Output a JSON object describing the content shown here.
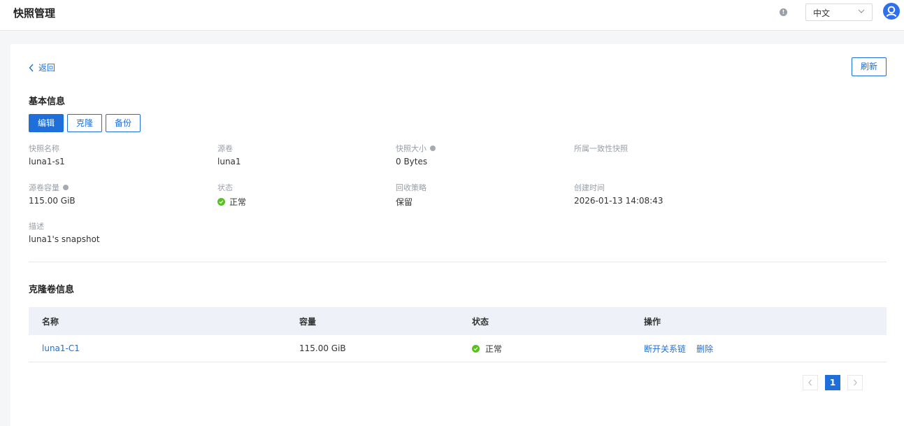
{
  "header": {
    "title": "快照管理",
    "language": "中文"
  },
  "toolbar": {
    "back_label": "返回",
    "refresh_label": "刷新"
  },
  "basic_info": {
    "title": "基本信息",
    "actions": {
      "edit": "编辑",
      "clone": "克隆",
      "backup": "备份"
    },
    "fields": {
      "snapshot_name": {
        "label": "快照名称",
        "value": "luna1-s1"
      },
      "source_volume": {
        "label": "源卷",
        "value": "luna1"
      },
      "snapshot_size": {
        "label": "快照大小",
        "value": "0 Bytes"
      },
      "consistency_group": {
        "label": "所属一致性快照",
        "value": ""
      },
      "source_capacity": {
        "label": "源卷容量",
        "value": "115.00 GiB"
      },
      "status": {
        "label": "状态",
        "value": "正常"
      },
      "recycle_policy": {
        "label": "回收策略",
        "value": "保留"
      },
      "created_at": {
        "label": "创建时间",
        "value": "2026-01-13 14:08:43"
      },
      "description": {
        "label": "描述",
        "value": "luna1's snapshot"
      }
    }
  },
  "clone_info": {
    "title": "克隆卷信息",
    "columns": {
      "name": "名称",
      "capacity": "容量",
      "status": "状态",
      "ops": "操作"
    },
    "rows": [
      {
        "name": "luna1-C1",
        "capacity": "115.00 GiB",
        "status": "正常",
        "op_unlink": "断开关系链",
        "op_delete": "删除"
      }
    ]
  },
  "pagination": {
    "current_page": "1"
  },
  "colors": {
    "primary": "#1e6fd9",
    "success": "#52c41a",
    "table_header_bg": "#eef2f8"
  }
}
